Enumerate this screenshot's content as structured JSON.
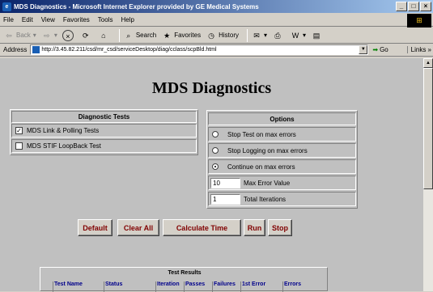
{
  "window": {
    "title": "MDS Diagnostics - Microsoft Internet Explorer provided by GE Medical Systems"
  },
  "menu": [
    "File",
    "Edit",
    "View",
    "Favorites",
    "Tools",
    "Help"
  ],
  "toolbar": {
    "back": "Back",
    "search": "Search",
    "favorites": "Favorites",
    "history": "History"
  },
  "address": {
    "label": "Address",
    "url": "http://3.45.82.211/csd/mr_csd/serviceDesktop/diag/cclass/scpBld.html",
    "go": "Go",
    "links": "Links »"
  },
  "page": {
    "heading": "MDS Diagnostics"
  },
  "tests": {
    "header": "Diagnostic Tests",
    "items": [
      {
        "label": "MDS Link & Polling Tests",
        "checked": true
      },
      {
        "label": "MDS STIF LoopBack Test",
        "checked": false
      }
    ]
  },
  "options": {
    "header": "Options",
    "radios": [
      {
        "label": "Stop Test on max errors",
        "selected": false
      },
      {
        "label": "Stop Logging on max errors",
        "selected": false
      },
      {
        "label": "Continue on max errors",
        "selected": true
      }
    ],
    "max_error_value": "10",
    "max_error_label": "Max Error Value",
    "total_iterations_value": "1",
    "total_iterations_label": "Total Iterations"
  },
  "buttons": {
    "default": "Default",
    "clear_all": "Clear All",
    "calculate_time": "Calculate Time",
    "run": "Run",
    "stop": "Stop"
  },
  "results": {
    "title": "Test Results",
    "columns": [
      "Test Name",
      "Status",
      "Iteration",
      "Passes",
      "Failures",
      "1st Error",
      "Errors"
    ]
  },
  "colors": {
    "title_bar": "#0a246a",
    "button_text": "#800000",
    "column_header": "#00008b"
  }
}
